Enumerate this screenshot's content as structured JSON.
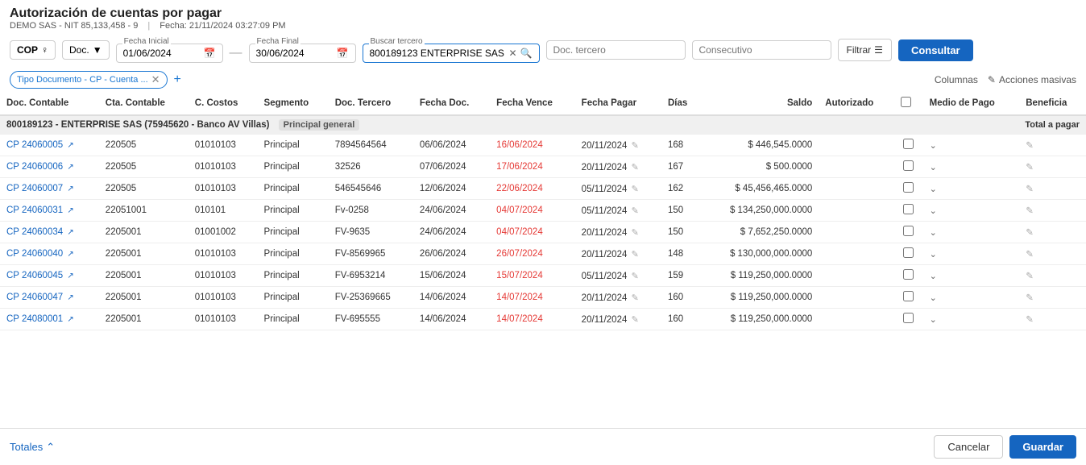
{
  "header": {
    "title": "Autorización de cuentas por pagar",
    "company": "DEMO SAS - NIT 85,133,458 - 9",
    "date_label": "Fecha: 21/11/2024 03:27:09 PM"
  },
  "toolbar": {
    "currency": "COP",
    "doc_label": "Doc.",
    "fecha_inicial_label": "Fecha Inicial",
    "fecha_inicial_value": "01/06/2024",
    "fecha_final_label": "Fecha Final",
    "fecha_final_value": "30/06/2024",
    "buscar_tercero_label": "Buscar tercero",
    "buscar_tercero_value": "800189123 ENTERPRISE SAS",
    "doc_tercero_placeholder": "Doc. tercero",
    "consecutivo_placeholder": "Consecutivo",
    "filtrar_label": "Filtrar",
    "consultar_label": "Consultar"
  },
  "filters": {
    "tag_label": "Tipo Documento - CP - Cuenta ...",
    "columns_label": "Columnas",
    "acciones_label": "Acciones masivas"
  },
  "table": {
    "columns": [
      "Doc. Contable",
      "Cta. Contable",
      "C. Costos",
      "Segmento",
      "Doc. Tercero",
      "Fecha Doc.",
      "Fecha Vence",
      "Fecha Pagar",
      "Días",
      "Saldo",
      "Autorizado",
      "",
      "Medio de Pago",
      "Beneficia"
    ],
    "group": {
      "label": "800189123 - ENTERPRISE SAS (75945620 - Banco AV Villas)",
      "badge": "Principal general",
      "total_label": "Total a pagar"
    },
    "rows": [
      {
        "doc_contable": "CP 24060005",
        "cta_contable": "220505",
        "c_costos": "01010103",
        "segmento": "Principal",
        "doc_tercero": "7894564564",
        "fecha_doc": "06/06/2024",
        "fecha_vence": "16/06/2024",
        "fecha_vence_red": true,
        "fecha_pagar": "20/11/2024",
        "dias": "168",
        "saldo": "$ 446,545.0000",
        "autorizado": false
      },
      {
        "doc_contable": "CP 24060006",
        "cta_contable": "220505",
        "c_costos": "01010103",
        "segmento": "Principal",
        "doc_tercero": "32526",
        "fecha_doc": "07/06/2024",
        "fecha_vence": "17/06/2024",
        "fecha_vence_red": true,
        "fecha_pagar": "20/11/2024",
        "dias": "167",
        "saldo": "$ 500.0000",
        "autorizado": false
      },
      {
        "doc_contable": "CP 24060007",
        "cta_contable": "220505",
        "c_costos": "01010103",
        "segmento": "Principal",
        "doc_tercero": "546545646",
        "fecha_doc": "12/06/2024",
        "fecha_vence": "22/06/2024",
        "fecha_vence_red": true,
        "fecha_pagar": "05/11/2024",
        "dias": "162",
        "saldo": "$ 45,456,465.0000",
        "autorizado": false
      },
      {
        "doc_contable": "CP 24060031",
        "cta_contable": "22051001",
        "c_costos": "010101",
        "segmento": "Principal",
        "doc_tercero": "Fv-0258",
        "fecha_doc": "24/06/2024",
        "fecha_vence": "04/07/2024",
        "fecha_vence_red": true,
        "fecha_pagar": "05/11/2024",
        "dias": "150",
        "saldo": "$ 134,250,000.0000",
        "autorizado": false
      },
      {
        "doc_contable": "CP 24060034",
        "cta_contable": "2205001",
        "c_costos": "01001002",
        "segmento": "Principal",
        "doc_tercero": "FV-9635",
        "fecha_doc": "24/06/2024",
        "fecha_vence": "04/07/2024",
        "fecha_vence_red": true,
        "fecha_pagar": "20/11/2024",
        "dias": "150",
        "saldo": "$ 7,652,250.0000",
        "autorizado": false
      },
      {
        "doc_contable": "CP 24060040",
        "cta_contable": "2205001",
        "c_costos": "01010103",
        "segmento": "Principal",
        "doc_tercero": "FV-8569965",
        "fecha_doc": "26/06/2024",
        "fecha_vence": "26/07/2024",
        "fecha_vence_red": true,
        "fecha_pagar": "20/11/2024",
        "dias": "148",
        "saldo": "$ 130,000,000.0000",
        "autorizado": false
      },
      {
        "doc_contable": "CP 24060045",
        "cta_contable": "2205001",
        "c_costos": "01010103",
        "segmento": "Principal",
        "doc_tercero": "FV-6953214",
        "fecha_doc": "15/06/2024",
        "fecha_vence": "15/07/2024",
        "fecha_vence_red": true,
        "fecha_pagar": "05/11/2024",
        "dias": "159",
        "saldo": "$ 119,250,000.0000",
        "autorizado": false
      },
      {
        "doc_contable": "CP 24060047",
        "cta_contable": "2205001",
        "c_costos": "01010103",
        "segmento": "Principal",
        "doc_tercero": "FV-25369665",
        "fecha_doc": "14/06/2024",
        "fecha_vence": "14/07/2024",
        "fecha_vence_red": true,
        "fecha_pagar": "20/11/2024",
        "dias": "160",
        "saldo": "$ 119,250,000.0000",
        "autorizado": false
      },
      {
        "doc_contable": "CP 24080001",
        "cta_contable": "2205001",
        "c_costos": "01010103",
        "segmento": "Principal",
        "doc_tercero": "FV-695555",
        "fecha_doc": "14/06/2024",
        "fecha_vence": "14/07/2024",
        "fecha_vence_red": true,
        "fecha_pagar": "20/11/2024",
        "dias": "160",
        "saldo": "$ 119,250,000.0000",
        "autorizado": false
      }
    ]
  },
  "footer": {
    "totales_label": "Totales",
    "cancel_label": "Cancelar",
    "guardar_label": "Guardar"
  }
}
